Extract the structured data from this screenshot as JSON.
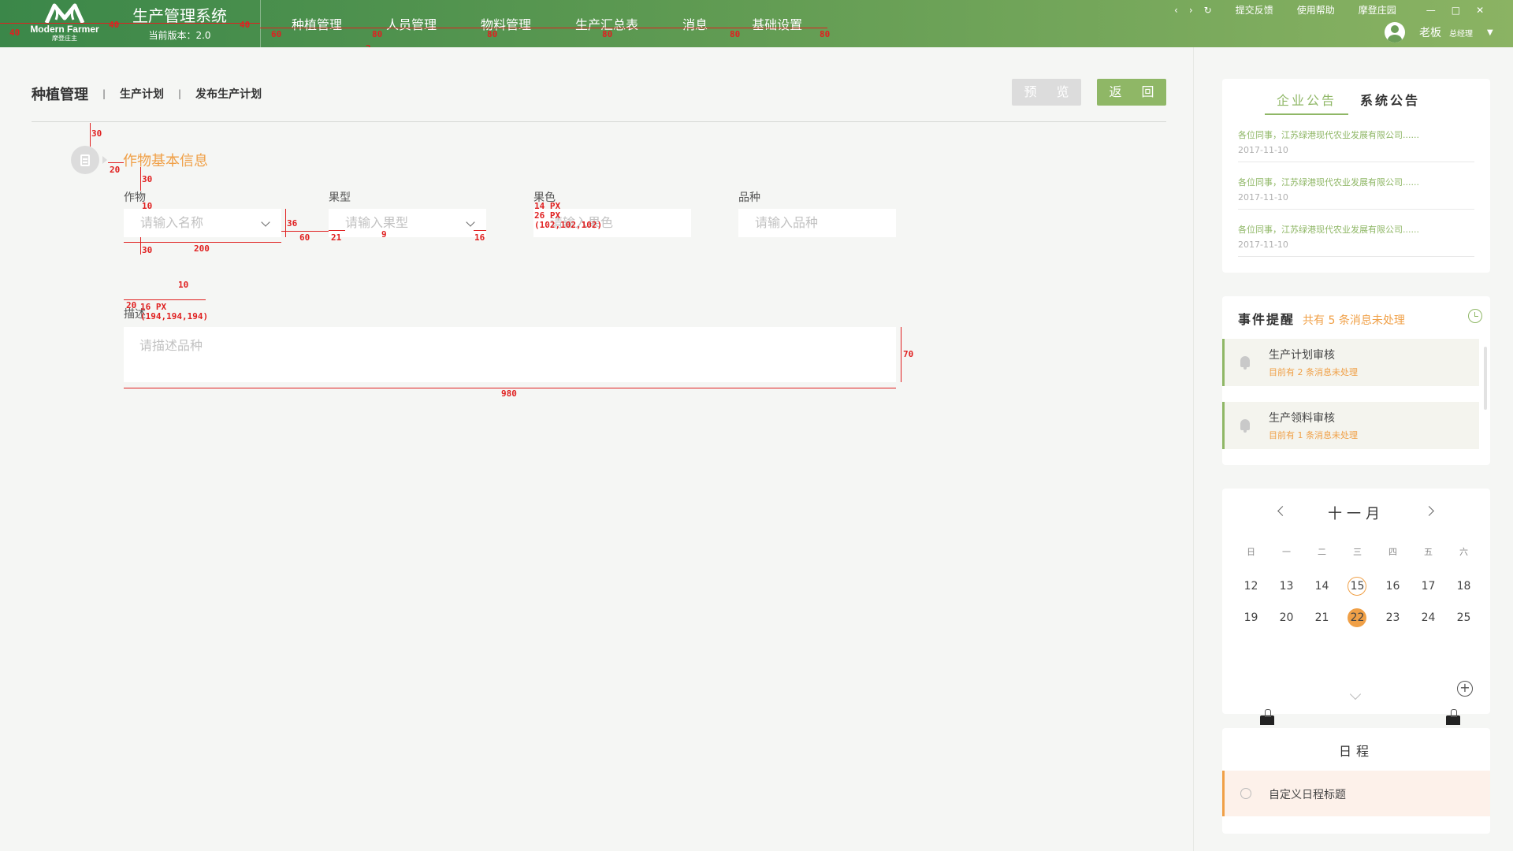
{
  "app": {
    "logo_en": "Modern Farmer",
    "logo_cn": "摩登庄主",
    "system_title": "生产管理系统",
    "version": "当前版本：2.0"
  },
  "nav": [
    "种植管理",
    "人员管理",
    "物料管理",
    "生产汇总表",
    "消息",
    "基础设置"
  ],
  "window": {
    "back_icon": "chevron-left-icon",
    "forward_icon": "chevron-right-icon",
    "refresh_icon": "refresh-icon",
    "links": [
      "提交反馈",
      "使用帮助",
      "摩登庄园"
    ]
  },
  "user": {
    "name": "老板",
    "role": "总经理"
  },
  "breadcrumb": {
    "main": "种植管理",
    "items": [
      "生产计划",
      "发布生产计划"
    ]
  },
  "buttons": {
    "preview": "预 览",
    "back": "返 回"
  },
  "section": {
    "title": "作物基本信息"
  },
  "form": {
    "crop_label": "作物",
    "crop_placeholder": "请输入名称",
    "fruit_type_label": "果型",
    "fruit_type_placeholder": "请输入果型",
    "fruit_color_label": "果色",
    "fruit_color_placeholder": "请输入果色",
    "variety_label": "品种",
    "variety_placeholder": "请输入品种",
    "desc_label": "描述",
    "desc_placeholder": "请描述品种"
  },
  "annotations": {
    "nav_spacing": [
      "40",
      "40",
      "40",
      "60",
      "80",
      "80",
      "80",
      "80",
      "80",
      "80"
    ],
    "tab_width": "106",
    "tab_gap": "2",
    "sec_top": "30",
    "sec_icon_gap": "20",
    "label_gap": "30",
    "label_field_gap": "10",
    "field_height": "36",
    "field_gap": "60",
    "field_width": "200",
    "field_pad": "21",
    "chev_gap": "9",
    "chev_right": "16",
    "field_bottom": "30",
    "font_note_1": "14 PX",
    "font_note_2": "26 PX",
    "font_note_3": "(102,102,102)",
    "desc_pad_top": "10",
    "desc_pad_left": "20",
    "desc_font": "16 PX",
    "desc_color": "(194,194,194)",
    "desc_height": "70",
    "desc_width": "980"
  },
  "notices": {
    "tab_active": "企业公告",
    "tab_inactive": "系统公告",
    "items": [
      {
        "text": "各位同事，江苏绿港现代农业发展有限公司......",
        "date": "2017-11-10"
      },
      {
        "text": "各位同事，江苏绿港现代农业发展有限公司......",
        "date": "2017-11-10"
      },
      {
        "text": "各位同事，江苏绿港现代农业发展有限公司......",
        "date": "2017-11-10"
      }
    ]
  },
  "events": {
    "title": "事件提醒",
    "summary": "共有 5 条消息未处理",
    "items": [
      {
        "name": "生产计划审核",
        "status": "目前有  2  条消息未处理"
      },
      {
        "name": "生产领料审核",
        "status": "目前有  1  条消息未处理"
      }
    ]
  },
  "calendar": {
    "month": "十一月",
    "weekdays": [
      "日",
      "一",
      "二",
      "三",
      "四",
      "五",
      "六"
    ],
    "week1": [
      "12",
      "13",
      "14",
      "15",
      "16",
      "17",
      "18"
    ],
    "week2": [
      "19",
      "20",
      "21",
      "22",
      "23",
      "24",
      "25"
    ],
    "today": "15",
    "selected": "22"
  },
  "schedule": {
    "title": "日程",
    "item": "自定义日程标题"
  },
  "colors": {
    "brand_green": "#8fb766",
    "accent_orange": "#f0a047",
    "annotation_red": "#e02020"
  }
}
